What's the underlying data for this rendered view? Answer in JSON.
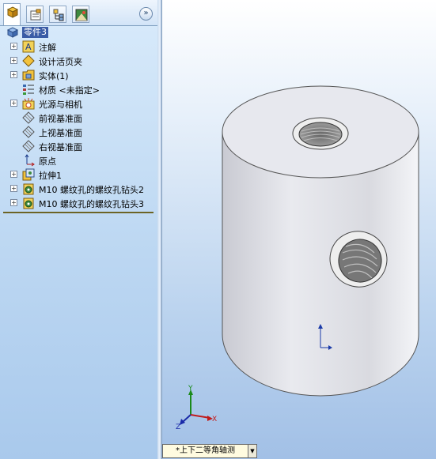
{
  "panel": {
    "tabs": [
      {
        "icon": "feature-manager-icon",
        "active": true
      },
      {
        "icon": "property-manager-icon",
        "active": false
      },
      {
        "icon": "configuration-manager-icon",
        "active": false
      },
      {
        "icon": "display-manager-icon",
        "active": false
      }
    ],
    "collapse_glyph": "»"
  },
  "tree": {
    "root_label": "零件3",
    "items": [
      {
        "label": "注解",
        "expandable": true,
        "icon": "annotation-icon"
      },
      {
        "label": "设计活页夹",
        "expandable": true,
        "icon": "design-binder-icon"
      },
      {
        "label": "实体(1)",
        "expandable": true,
        "icon": "solid-bodies-icon"
      },
      {
        "label": "材质 <未指定>",
        "expandable": false,
        "icon": "material-icon"
      },
      {
        "label": "光源与相机",
        "expandable": true,
        "icon": "lights-cameras-icon"
      },
      {
        "label": "前视基准面",
        "expandable": false,
        "icon": "plane-icon"
      },
      {
        "label": "上视基准面",
        "expandable": false,
        "icon": "plane-icon"
      },
      {
        "label": "右视基准面",
        "expandable": false,
        "icon": "plane-icon"
      },
      {
        "label": "原点",
        "expandable": false,
        "icon": "origin-icon"
      },
      {
        "label": "拉伸1",
        "expandable": true,
        "icon": "extrude-icon"
      },
      {
        "label": "M10 螺纹孔的螺纹孔钻头2",
        "expandable": true,
        "icon": "hole-wizard-icon"
      },
      {
        "label": "M10 螺纹孔的螺纹孔钻头3",
        "expandable": true,
        "icon": "hole-wizard-icon"
      }
    ]
  },
  "viewport": {
    "view_name": "*上下二等角轴测",
    "triad": {
      "x_label": "X",
      "y_label": "Y",
      "z_label": "Z"
    }
  },
  "colors": {
    "selection": "#3a5ca6",
    "part_gray": "#dcdde3"
  }
}
